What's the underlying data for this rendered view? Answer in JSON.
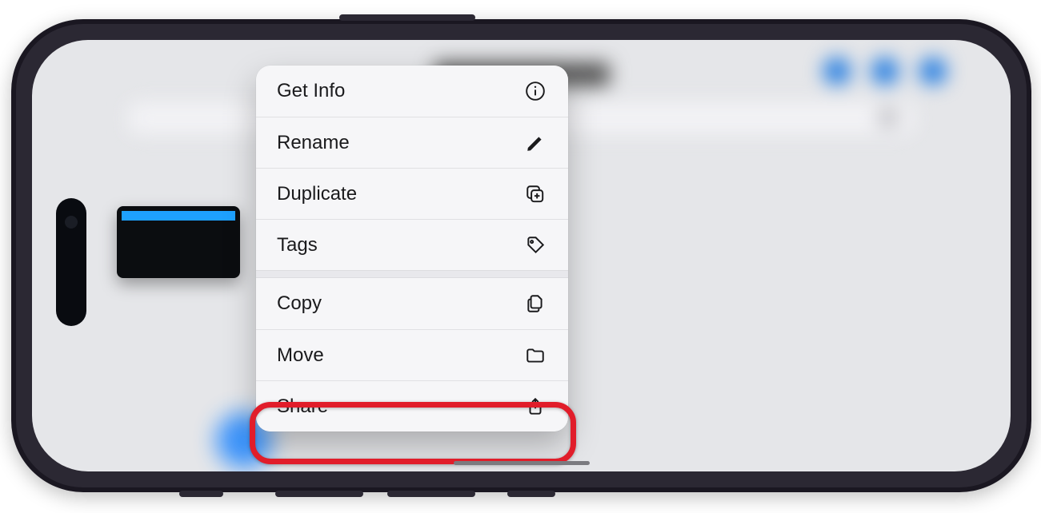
{
  "context_menu": {
    "group1": [
      {
        "label": "Get Info",
        "icon": "info-icon"
      },
      {
        "label": "Rename",
        "icon": "pencil-icon"
      },
      {
        "label": "Duplicate",
        "icon": "plus-square-icon"
      },
      {
        "label": "Tags",
        "icon": "tag-icon"
      }
    ],
    "group2": [
      {
        "label": "Copy",
        "icon": "doc-on-doc-icon"
      },
      {
        "label": "Move",
        "icon": "folder-icon"
      },
      {
        "label": "Share",
        "icon": "share-icon",
        "highlighted": true
      }
    ]
  },
  "annotation": {
    "highlight_target": "Share",
    "highlight_color": "#e11d2a"
  }
}
